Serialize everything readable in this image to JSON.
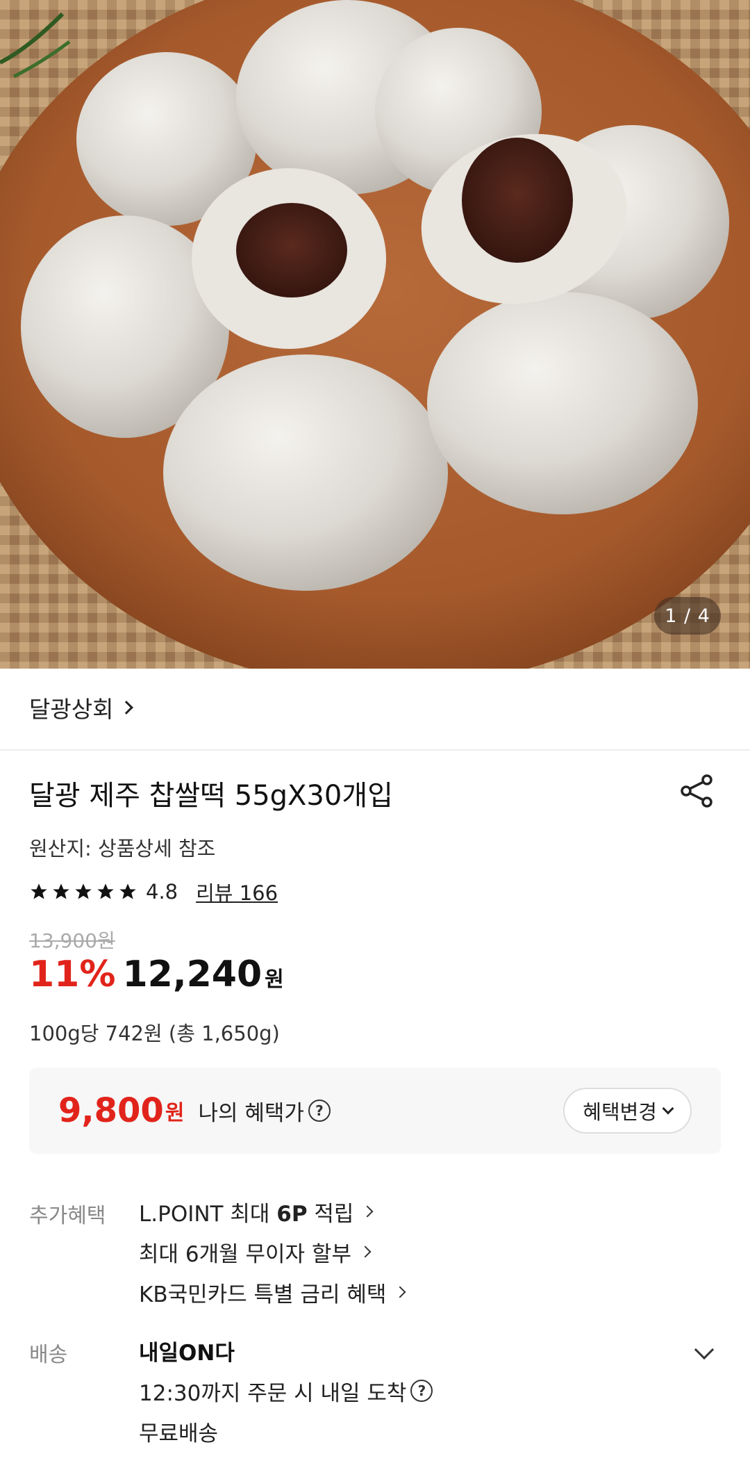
{
  "gallery": {
    "counter": "1 / 4",
    "alt": "찹쌀떡 상품 이미지"
  },
  "seller": {
    "name": "달광상회"
  },
  "product": {
    "title": "달광 제주 찹쌀떡 55gX30개입",
    "origin": "원산지: 상품상세 참조",
    "rating": "4.8",
    "rating_stars": 5,
    "review_label": "리뷰 166",
    "original_price": "13,900원",
    "discount": "11%",
    "price": "12,240",
    "price_unit": "원",
    "unit_price": "100g당 742원 (총 1,650g)"
  },
  "my_benefit": {
    "price": "9,800",
    "price_unit": "원",
    "label": "나의 혜택가",
    "help_icon": "?",
    "change_button": "혜택변경"
  },
  "extra_benefits": {
    "label": "추가혜택",
    "items": [
      {
        "prefix": "L.POINT 최대 ",
        "bold": "6P",
        "suffix": " 적립"
      },
      {
        "prefix": "최대 6개월 무이자 할부",
        "bold": "",
        "suffix": ""
      },
      {
        "prefix": "KB국민카드 특별 금리 혜택",
        "bold": "",
        "suffix": ""
      }
    ]
  },
  "delivery": {
    "label": "배송",
    "title": "내일ON다",
    "eta": "12:30까지 주문 시 내일 도착",
    "help_icon": "?",
    "fee": "무료배송"
  },
  "colors": {
    "accent_red": "#e1241b",
    "benefit_bg": "#f7f7f7"
  }
}
